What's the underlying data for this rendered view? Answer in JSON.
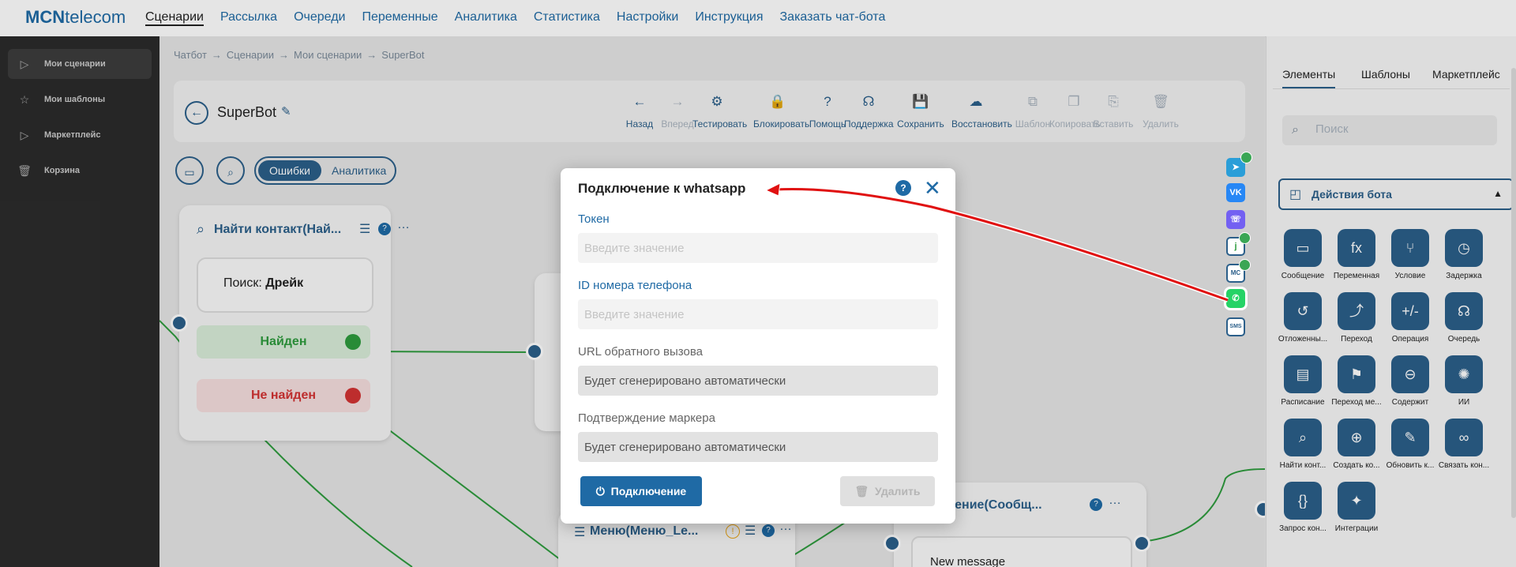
{
  "brand": {
    "logo_bold": "MCN",
    "logo_rest": "telecom"
  },
  "topnav": [
    "Сценарии",
    "Рассылка",
    "Очереди",
    "Переменные",
    "Аналитика",
    "Статистика",
    "Настройки",
    "Инструкция",
    "Заказать чат-бота"
  ],
  "sidebar": [
    {
      "label": "Мои сценарии",
      "icon": "play-icon"
    },
    {
      "label": "Мои шаблоны",
      "icon": "star-icon"
    },
    {
      "label": "Маркетплейс",
      "icon": "play-icon"
    },
    {
      "label": "Корзина",
      "icon": "trash-icon"
    }
  ],
  "breadcrumb": [
    "Чатбот",
    "Сценарии",
    "Мои сценарии",
    "SuperBot"
  ],
  "bot_title": "SuperBot",
  "toolbar": [
    {
      "label": "Назад",
      "icon": "←",
      "disabled": false
    },
    {
      "label": "Вперед",
      "icon": "→",
      "disabled": true
    },
    {
      "label": "Тестировать",
      "icon": "⚙",
      "disabled": false
    },
    {
      "label": "Блокировать",
      "icon": "🔒",
      "disabled": false
    },
    {
      "label": "Помощь",
      "icon": "?",
      "disabled": false
    },
    {
      "label": "Поддержка",
      "icon": "☊",
      "disabled": false
    },
    {
      "label": "Сохранить",
      "icon": "💾",
      "disabled": false
    },
    {
      "label": "Восстановить",
      "icon": "☁",
      "disabled": false
    },
    {
      "label": "Шаблон",
      "icon": "⧉",
      "disabled": true
    },
    {
      "label": "Копировать",
      "icon": "❐",
      "disabled": true
    },
    {
      "label": "Вставить",
      "icon": "⎘",
      "disabled": true
    },
    {
      "label": "Удалить",
      "icon": "🗑",
      "disabled": true
    }
  ],
  "toggle": {
    "on": "Ошибки",
    "off": "Аналитика"
  },
  "nodes": {
    "find_contact": {
      "title": "Найти контакт(Най...",
      "search_label": "Поиск:",
      "search_value": "Дрейк",
      "found": "Найден",
      "not_found": "Не найден"
    },
    "menu": {
      "title": "Меню(Меню_Le..."
    },
    "message": {
      "title": "общение(Сообщ...",
      "text": "New message"
    }
  },
  "right_panel": {
    "tabs": [
      "Элементы",
      "Шаблоны",
      "Маркетплейс"
    ],
    "search_placeholder": "Поиск",
    "section": "Действия бота",
    "items": [
      {
        "label": "Сообщение",
        "icon": "message-icon",
        "glyph": "▭"
      },
      {
        "label": "Переменная",
        "icon": "variable-icon",
        "glyph": "fx"
      },
      {
        "label": "Условие",
        "icon": "condition-icon",
        "glyph": "⑂"
      },
      {
        "label": "Задержка",
        "icon": "timer-icon",
        "glyph": "◷"
      },
      {
        "label": "Отложенны...",
        "icon": "deferred-icon",
        "glyph": "↺"
      },
      {
        "label": "Переход",
        "icon": "jump-icon",
        "glyph": "⤴"
      },
      {
        "label": "Операция",
        "icon": "operation-icon",
        "glyph": "+/-"
      },
      {
        "label": "Очередь",
        "icon": "queue-icon",
        "glyph": "☊"
      },
      {
        "label": "Расписание",
        "icon": "schedule-icon",
        "glyph": "▤"
      },
      {
        "label": "Переход ме...",
        "icon": "run-icon",
        "glyph": "⚑"
      },
      {
        "label": "Содержит",
        "icon": "contains-icon",
        "glyph": "⊖"
      },
      {
        "label": "ИИ",
        "icon": "ai-icon",
        "glyph": "✺"
      },
      {
        "label": "Найти конт...",
        "icon": "find-contact-icon",
        "glyph": "⌕"
      },
      {
        "label": "Создать ко...",
        "icon": "create-contact-icon",
        "glyph": "⊕"
      },
      {
        "label": "Обновить к...",
        "icon": "update-contact-icon",
        "glyph": "✎"
      },
      {
        "label": "Связать кон...",
        "icon": "link-contact-icon",
        "glyph": "∞"
      },
      {
        "label": "Запрос кон...",
        "icon": "request-icon",
        "glyph": "{}"
      },
      {
        "label": "Интеграции",
        "icon": "puzzle-icon",
        "glyph": "✦"
      }
    ]
  },
  "modal": {
    "title": "Подключение к whatsapp",
    "fields": [
      {
        "label": "Токен",
        "placeholder": "Введите значение",
        "required": true
      },
      {
        "label": "ID номера телефона",
        "placeholder": "Введите значение",
        "required": true
      },
      {
        "label": "URL обратного вызова",
        "placeholder": "Будет сгенерировано автоматически",
        "required": false
      },
      {
        "label": "Подтверждение маркера",
        "placeholder": "Будет сгенерировано автоматически",
        "required": false
      }
    ],
    "connect_label": "Подключение",
    "delete_label": "Удалить"
  },
  "colors": {
    "accent": "#1f6aa5",
    "dark": "#2b5f8a",
    "found": "#2e9b3e",
    "not_found": "#d33333",
    "arrow": "#e01010"
  }
}
